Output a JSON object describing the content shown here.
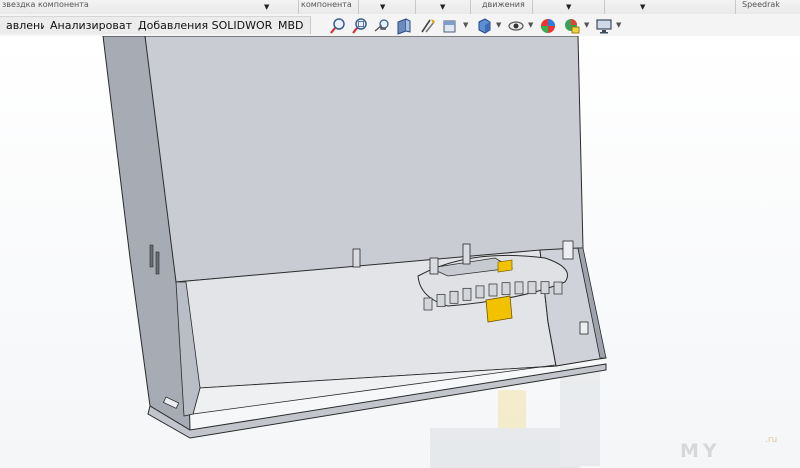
{
  "ribbon_top": {
    "partial_labels": [
      "звездка компонента",
      "компонента",
      "движения",
      "Speedrak"
    ]
  },
  "tabs": [
    {
      "label": "авление"
    },
    {
      "label": "Анализировать"
    },
    {
      "label": "Добавления SOLIDWORKS"
    },
    {
      "label": "MBD"
    }
  ],
  "view_toolbar": {
    "icons": [
      "zoom-to-fit-icon",
      "zoom-area-icon",
      "previous-view-icon",
      "section-view-icon",
      "dynamic-annotation-icon",
      "view-orientation-icon",
      "display-style-icon",
      "hide-show-items-icon",
      "edit-appearance-icon",
      "apply-scene-icon",
      "view-settings-icon"
    ]
  },
  "watermark": {
    "text": "MY",
    "suffix": ".ru"
  },
  "colors": {
    "part_gray": "#c9ccd3",
    "part_dark": "#9fa3ad",
    "accent_yellow": "#f2c200",
    "edge": "#2b2b2b"
  }
}
